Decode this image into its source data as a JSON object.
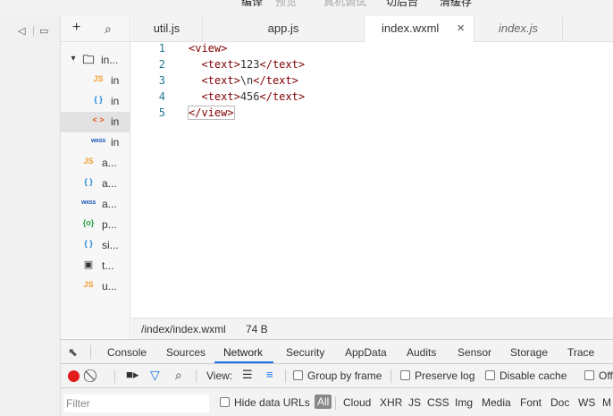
{
  "toolbar": {
    "items": [
      {
        "label": "编译",
        "dim": false
      },
      {
        "label": "预览",
        "dim": true
      },
      {
        "label": "真机调试",
        "dim": true
      },
      {
        "label": "切后台",
        "dim": false
      },
      {
        "label": "清缓存",
        "dim": false
      }
    ]
  },
  "tree": {
    "add_label": "+",
    "search_label": "⚲",
    "items": [
      {
        "icon": "▾",
        "name": "in...",
        "type": "folder"
      },
      {
        "icon": "JS",
        "name": "in",
        "type": "js"
      },
      {
        "icon": "{ }",
        "name": "in",
        "type": "json"
      },
      {
        "icon": "< >",
        "name": "in",
        "type": "wxml",
        "selected": true
      },
      {
        "icon": "wxss",
        "name": "in",
        "type": "wxss"
      },
      {
        "icon": "JS",
        "name": "a...",
        "type": "js"
      },
      {
        "icon": "{ }",
        "name": "a...",
        "type": "json"
      },
      {
        "icon": "wxss",
        "name": "a...",
        "type": "wxss"
      },
      {
        "icon": "{o}",
        "name": "p...",
        "type": "comp"
      },
      {
        "icon": "{ }",
        "name": "si...",
        "type": "json"
      },
      {
        "icon": "▣",
        "name": "t...",
        "type": "img"
      },
      {
        "icon": "JS",
        "name": "u...",
        "type": "js"
      }
    ]
  },
  "tabs": [
    {
      "label": "util.js",
      "active": false,
      "italic": false
    },
    {
      "label": "app.js",
      "active": false,
      "italic": false
    },
    {
      "label": "index.wxml",
      "active": true,
      "italic": false,
      "close": "×"
    },
    {
      "label": "index.js",
      "active": false,
      "italic": true
    }
  ],
  "editor": {
    "lines": [
      {
        "num": "1",
        "indent": "",
        "open": "<view>",
        "content": "",
        "close": ""
      },
      {
        "num": "2",
        "indent": "  ",
        "open": "<text>",
        "content": "123",
        "close": "</text>"
      },
      {
        "num": "3",
        "indent": "  ",
        "open": "<text>",
        "content": "\\n",
        "close": "</text>"
      },
      {
        "num": "4",
        "indent": "  ",
        "open": "<text>",
        "content": "456",
        "close": "</text>"
      },
      {
        "num": "5",
        "indent": "",
        "open": "</view>",
        "content": "",
        "close": ""
      }
    ]
  },
  "status": {
    "path": "/index/index.wxml",
    "size": "74 B"
  },
  "devtools": {
    "tabs": [
      "Console",
      "Sources",
      "Network",
      "Security",
      "AppData",
      "Audits",
      "Sensor",
      "Storage",
      "Trace"
    ],
    "active_tab": "Network",
    "view_label": "View:",
    "group_by_frame": "Group by frame",
    "preserve_log": "Preserve log",
    "disable_cache": "Disable cache",
    "offline": "Off",
    "filter_placeholder": "Filter",
    "hide_data_urls": "Hide data URLs",
    "filter_types": [
      "All",
      "Cloud",
      "XHR",
      "JS",
      "CSS",
      "Img",
      "Media",
      "Font",
      "Doc",
      "WS",
      "M"
    ]
  }
}
